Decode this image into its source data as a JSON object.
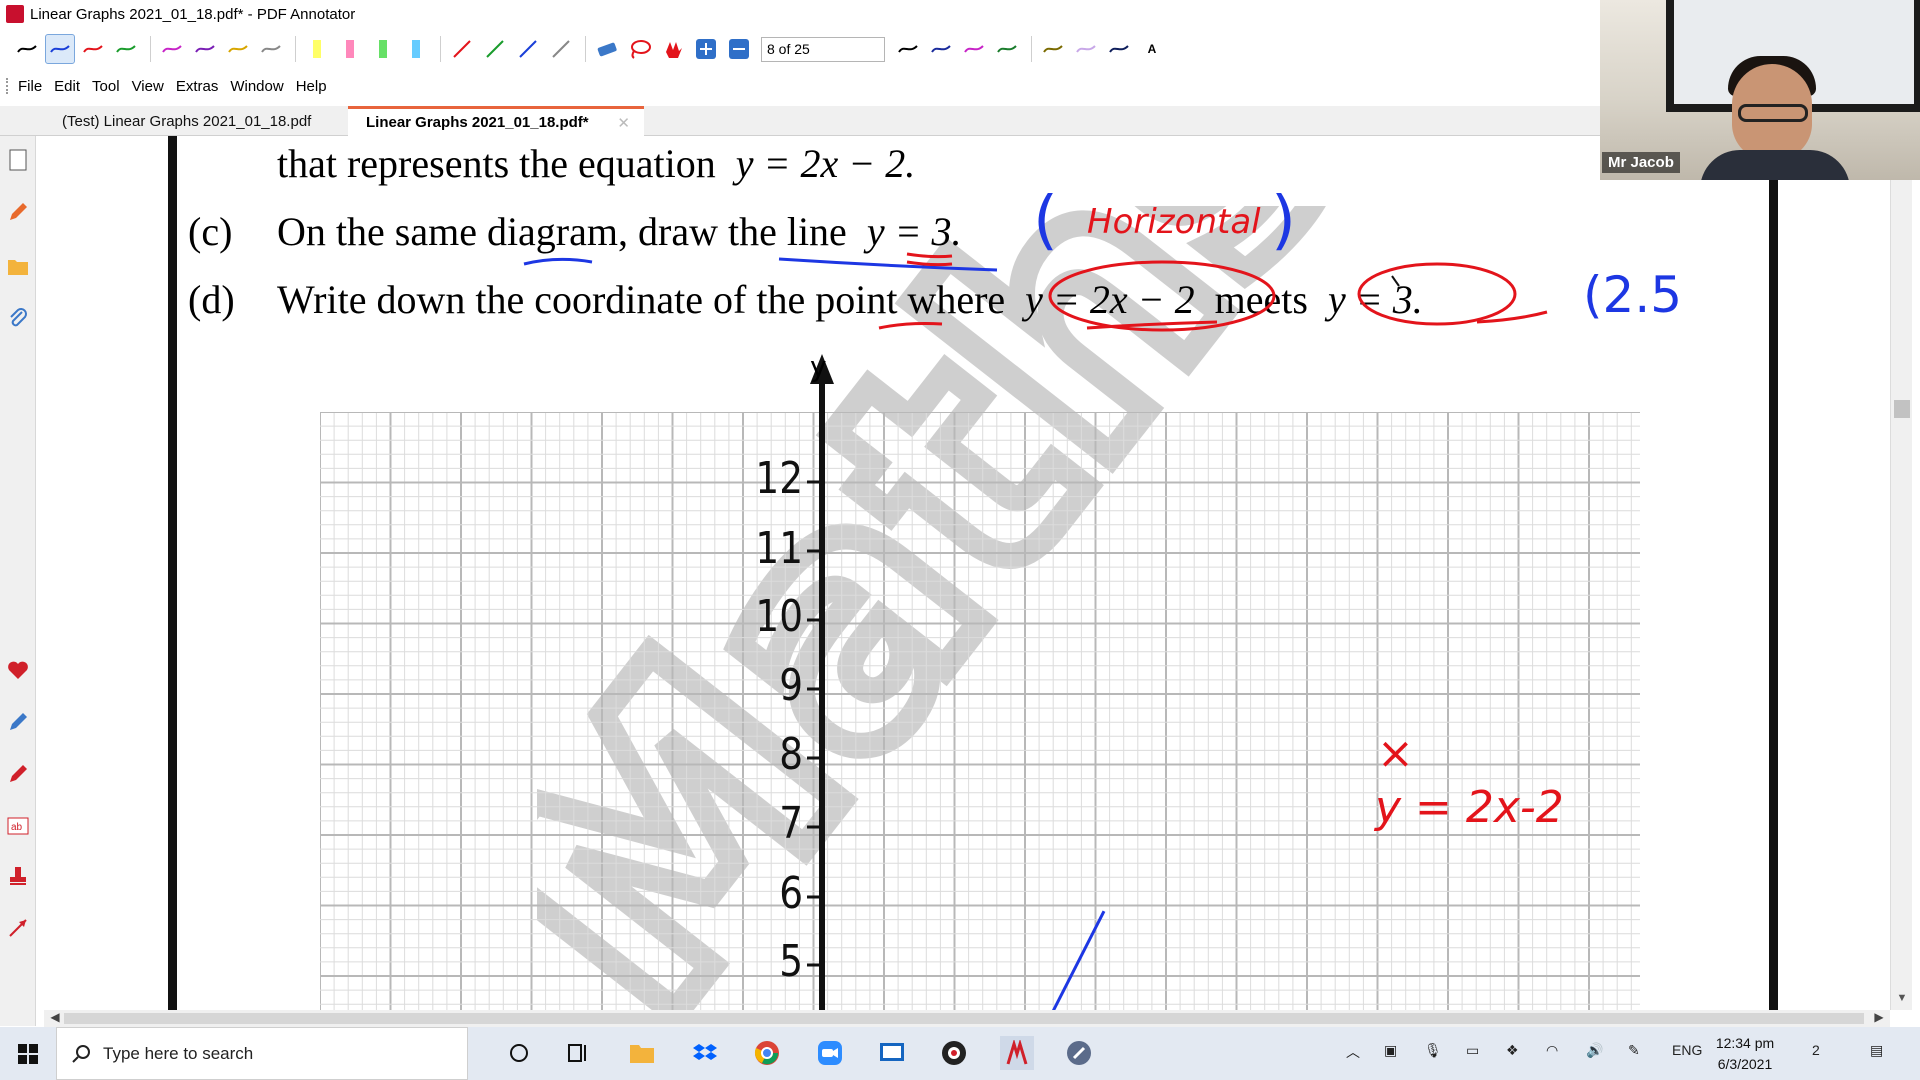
{
  "window": {
    "title": "Linear Graphs 2021_01_18.pdf* - PDF Annotator",
    "page_indicator": "8 of 25"
  },
  "toolbar": {
    "pen_colors": [
      "#000000",
      "#1a3fd8",
      "#e3141b",
      "#1a9c2c",
      "#c724c7",
      "#7a1fb5",
      "#d8a600",
      "#888888"
    ],
    "highlighter_colors": [
      "#ffff66",
      "#ff88bb",
      "#66e066",
      "#66ccff"
    ],
    "line_colors": [
      "#e3141b",
      "#1a9c2c",
      "#1a3fd8",
      "#888888"
    ],
    "text_tool_label": "A"
  },
  "menu": {
    "items": [
      "File",
      "Edit",
      "Tool",
      "View",
      "Extras",
      "Window",
      "Help"
    ]
  },
  "tabs": [
    {
      "label": "(Test) Linear Graphs 2021_01_18.pdf",
      "active": false
    },
    {
      "label": "Linear Graphs 2021_01_18.pdf*",
      "active": true
    }
  ],
  "document": {
    "line1": {
      "text": "that represents the equation",
      "eq": "y = 2x − 2."
    },
    "line_c": {
      "label": "(c)",
      "text": "On the same diagram, draw the line",
      "eq": "y = 3."
    },
    "line_d": {
      "label": "(d)",
      "text": "Write down the coordinate of the point where",
      "eq1": "y = 2x − 2",
      "mid": "meets",
      "eq2": "y = 3."
    },
    "axis_label": "y",
    "y_ticks": [
      "12",
      "11",
      "10",
      "9",
      "8",
      "7",
      "6",
      "5"
    ],
    "watermark": "MathsBattle"
  },
  "annotations": {
    "horizontal_note": "Horizontal",
    "paren_open": "(",
    "paren_close": ")",
    "answer_start": "(2.5",
    "line_label": "y = 2x-2",
    "cross_mark": "×"
  },
  "chart_data": {
    "type": "line",
    "ylabel": "y",
    "y_ticks": [
      12,
      11,
      10,
      9,
      8,
      7,
      6,
      5
    ],
    "series": [
      {
        "name": "y = 2x-2",
        "x": [
          3.0,
          4.0
        ],
        "y": [
          4.0,
          6.0
        ]
      }
    ]
  },
  "webcam": {
    "name": "Mr Jacob"
  },
  "taskbar": {
    "search_placeholder": "Type here to search",
    "language": "ENG",
    "time": "12:34 pm",
    "date": "6/3/2021",
    "notification_count": "2"
  }
}
